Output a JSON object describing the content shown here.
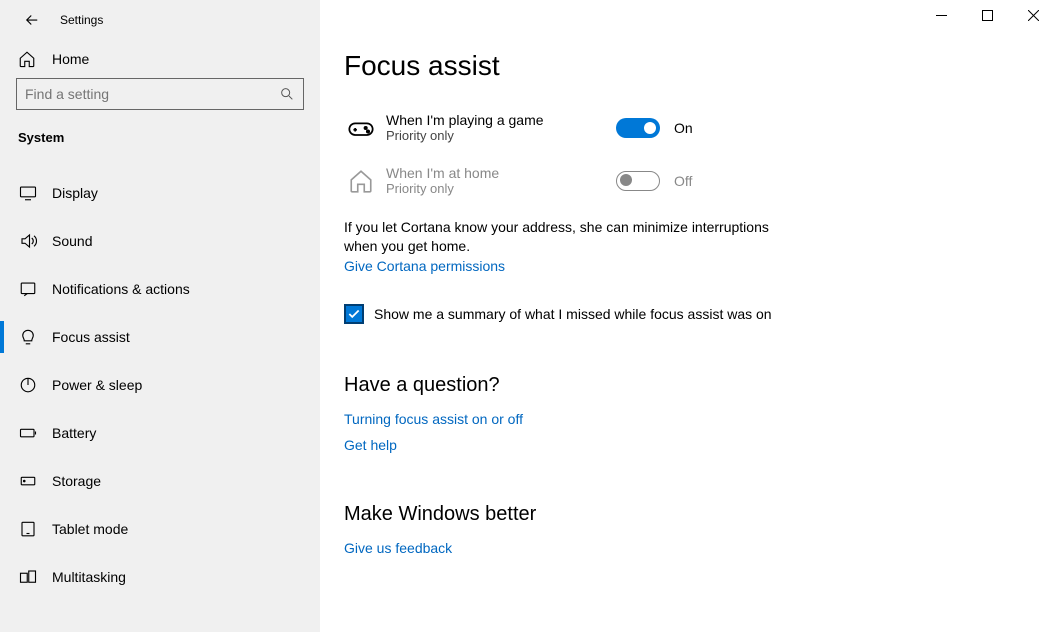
{
  "app": {
    "title": "Settings"
  },
  "sidebar": {
    "home": "Home",
    "search_placeholder": "Find a setting",
    "section": "System",
    "items": [
      {
        "label": "Display",
        "icon": "display"
      },
      {
        "label": "Sound",
        "icon": "sound"
      },
      {
        "label": "Notifications & actions",
        "icon": "notifications"
      },
      {
        "label": "Focus assist",
        "icon": "focus",
        "active": true
      },
      {
        "label": "Power & sleep",
        "icon": "power"
      },
      {
        "label": "Battery",
        "icon": "battery"
      },
      {
        "label": "Storage",
        "icon": "storage"
      },
      {
        "label": "Tablet mode",
        "icon": "tablet"
      },
      {
        "label": "Multitasking",
        "icon": "multitasking"
      }
    ]
  },
  "page": {
    "title": "Focus assist",
    "rules": {
      "game": {
        "title": "When I'm playing a game",
        "sub": "Priority only",
        "toggle_label": "On",
        "toggle_on": true
      },
      "home": {
        "title": "When I'm at home",
        "sub": "Priority only",
        "toggle_label": "Off",
        "toggle_on": false,
        "disabled": true
      }
    },
    "cortana_hint": "If you let Cortana know your address, she can minimize interruptions when you get home.",
    "cortana_link": "Give Cortana permissions",
    "summary_checkbox": {
      "checked": true,
      "label": "Show me a summary of what I missed while focus assist was on"
    },
    "question": {
      "heading": "Have a question?",
      "links": [
        "Turning focus assist on or off",
        "Get help"
      ]
    },
    "feedback": {
      "heading": "Make Windows better",
      "link": "Give us feedback"
    }
  }
}
